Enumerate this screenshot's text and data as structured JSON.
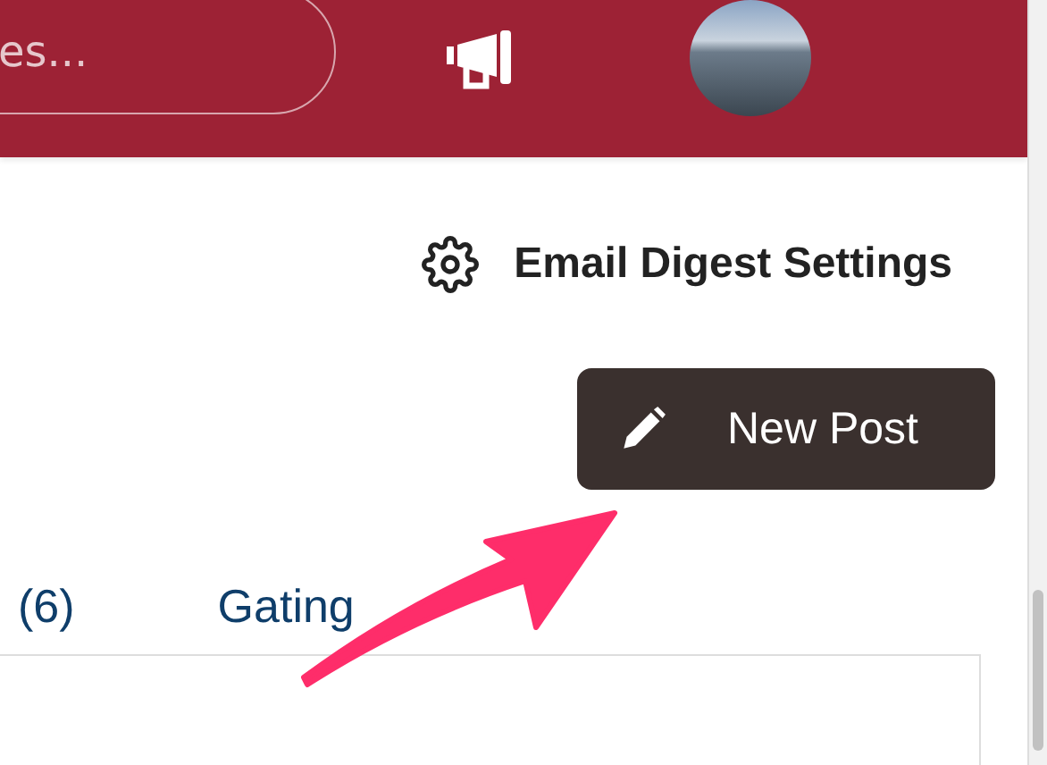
{
  "header": {
    "search": {
      "placeholder": "es..."
    }
  },
  "digest_link": {
    "label": "Email Digest Settings"
  },
  "new_post_button": {
    "label": "New Post"
  },
  "tabs": [
    {
      "label": "(6)",
      "selected": false
    },
    {
      "label": "Gating",
      "selected": false
    }
  ]
}
